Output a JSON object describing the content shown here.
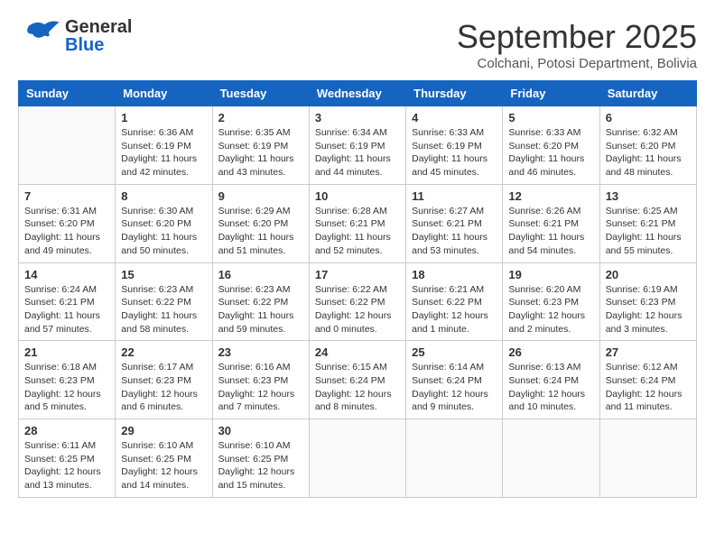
{
  "header": {
    "logo_general": "General",
    "logo_blue": "Blue",
    "month": "September 2025",
    "location": "Colchani, Potosi Department, Bolivia"
  },
  "days_of_week": [
    "Sunday",
    "Monday",
    "Tuesday",
    "Wednesday",
    "Thursday",
    "Friday",
    "Saturday"
  ],
  "weeks": [
    [
      {
        "day": "",
        "info": ""
      },
      {
        "day": "1",
        "info": "Sunrise: 6:36 AM\nSunset: 6:19 PM\nDaylight: 11 hours\nand 42 minutes."
      },
      {
        "day": "2",
        "info": "Sunrise: 6:35 AM\nSunset: 6:19 PM\nDaylight: 11 hours\nand 43 minutes."
      },
      {
        "day": "3",
        "info": "Sunrise: 6:34 AM\nSunset: 6:19 PM\nDaylight: 11 hours\nand 44 minutes."
      },
      {
        "day": "4",
        "info": "Sunrise: 6:33 AM\nSunset: 6:19 PM\nDaylight: 11 hours\nand 45 minutes."
      },
      {
        "day": "5",
        "info": "Sunrise: 6:33 AM\nSunset: 6:20 PM\nDaylight: 11 hours\nand 46 minutes."
      },
      {
        "day": "6",
        "info": "Sunrise: 6:32 AM\nSunset: 6:20 PM\nDaylight: 11 hours\nand 48 minutes."
      }
    ],
    [
      {
        "day": "7",
        "info": "Sunrise: 6:31 AM\nSunset: 6:20 PM\nDaylight: 11 hours\nand 49 minutes."
      },
      {
        "day": "8",
        "info": "Sunrise: 6:30 AM\nSunset: 6:20 PM\nDaylight: 11 hours\nand 50 minutes."
      },
      {
        "day": "9",
        "info": "Sunrise: 6:29 AM\nSunset: 6:20 PM\nDaylight: 11 hours\nand 51 minutes."
      },
      {
        "day": "10",
        "info": "Sunrise: 6:28 AM\nSunset: 6:21 PM\nDaylight: 11 hours\nand 52 minutes."
      },
      {
        "day": "11",
        "info": "Sunrise: 6:27 AM\nSunset: 6:21 PM\nDaylight: 11 hours\nand 53 minutes."
      },
      {
        "day": "12",
        "info": "Sunrise: 6:26 AM\nSunset: 6:21 PM\nDaylight: 11 hours\nand 54 minutes."
      },
      {
        "day": "13",
        "info": "Sunrise: 6:25 AM\nSunset: 6:21 PM\nDaylight: 11 hours\nand 55 minutes."
      }
    ],
    [
      {
        "day": "14",
        "info": "Sunrise: 6:24 AM\nSunset: 6:21 PM\nDaylight: 11 hours\nand 57 minutes."
      },
      {
        "day": "15",
        "info": "Sunrise: 6:23 AM\nSunset: 6:22 PM\nDaylight: 11 hours\nand 58 minutes."
      },
      {
        "day": "16",
        "info": "Sunrise: 6:23 AM\nSunset: 6:22 PM\nDaylight: 11 hours\nand 59 minutes."
      },
      {
        "day": "17",
        "info": "Sunrise: 6:22 AM\nSunset: 6:22 PM\nDaylight: 12 hours\nand 0 minutes."
      },
      {
        "day": "18",
        "info": "Sunrise: 6:21 AM\nSunset: 6:22 PM\nDaylight: 12 hours\nand 1 minute."
      },
      {
        "day": "19",
        "info": "Sunrise: 6:20 AM\nSunset: 6:23 PM\nDaylight: 12 hours\nand 2 minutes."
      },
      {
        "day": "20",
        "info": "Sunrise: 6:19 AM\nSunset: 6:23 PM\nDaylight: 12 hours\nand 3 minutes."
      }
    ],
    [
      {
        "day": "21",
        "info": "Sunrise: 6:18 AM\nSunset: 6:23 PM\nDaylight: 12 hours\nand 5 minutes."
      },
      {
        "day": "22",
        "info": "Sunrise: 6:17 AM\nSunset: 6:23 PM\nDaylight: 12 hours\nand 6 minutes."
      },
      {
        "day": "23",
        "info": "Sunrise: 6:16 AM\nSunset: 6:23 PM\nDaylight: 12 hours\nand 7 minutes."
      },
      {
        "day": "24",
        "info": "Sunrise: 6:15 AM\nSunset: 6:24 PM\nDaylight: 12 hours\nand 8 minutes."
      },
      {
        "day": "25",
        "info": "Sunrise: 6:14 AM\nSunset: 6:24 PM\nDaylight: 12 hours\nand 9 minutes."
      },
      {
        "day": "26",
        "info": "Sunrise: 6:13 AM\nSunset: 6:24 PM\nDaylight: 12 hours\nand 10 minutes."
      },
      {
        "day": "27",
        "info": "Sunrise: 6:12 AM\nSunset: 6:24 PM\nDaylight: 12 hours\nand 11 minutes."
      }
    ],
    [
      {
        "day": "28",
        "info": "Sunrise: 6:11 AM\nSunset: 6:25 PM\nDaylight: 12 hours\nand 13 minutes."
      },
      {
        "day": "29",
        "info": "Sunrise: 6:10 AM\nSunset: 6:25 PM\nDaylight: 12 hours\nand 14 minutes."
      },
      {
        "day": "30",
        "info": "Sunrise: 6:10 AM\nSunset: 6:25 PM\nDaylight: 12 hours\nand 15 minutes."
      },
      {
        "day": "",
        "info": ""
      },
      {
        "day": "",
        "info": ""
      },
      {
        "day": "",
        "info": ""
      },
      {
        "day": "",
        "info": ""
      }
    ]
  ]
}
